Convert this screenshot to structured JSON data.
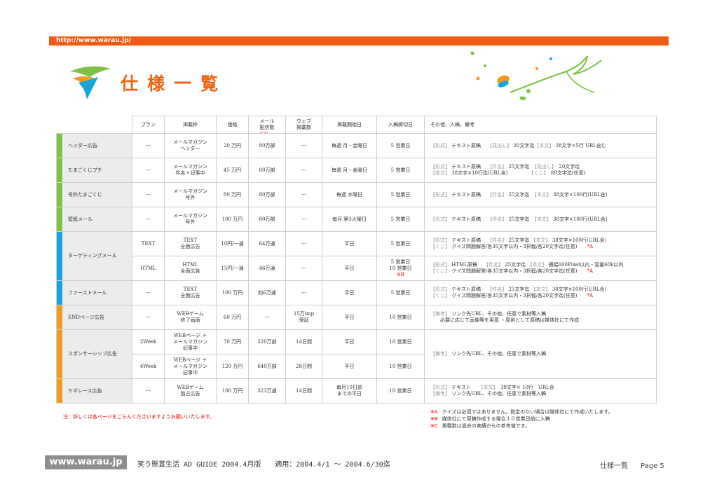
{
  "header": {
    "url": "http://www.warau.jp/"
  },
  "page_title": "仕様一覧",
  "table": {
    "headers": [
      "",
      "プラン",
      "掲載枠",
      "価格",
      "メール\n配信数",
      "ウェブ\n掲載数",
      "掲載開始日",
      "入稿締切日",
      "その他、入稿、備考"
    ],
    "header_note": "※C",
    "rows": {
      "header_ad": {
        "cat": "ヘッダー広告",
        "plan": "---",
        "slot": "メールマガジン\nヘッダー",
        "price": "20 万円",
        "mail": "80万部",
        "web": "---",
        "start": "毎週 月・金曜日",
        "deadline": "5 営業日",
        "spec": {
          "l1_tag": "【形式】",
          "l1_a": " テキスト原稿　 ",
          "l1_tag2": "【見出し】",
          "l1_b": " 20文字迄",
          "l1_tag3": "【本文】",
          "l1_c": " 38文字×5行 URL含む"
        }
      },
      "tamagokubuchi": {
        "cat": "たまごくじプチ",
        "plan": "---",
        "slot": "メールマガジン\n件名＋記事中",
        "price": "45 万円",
        "mail": "80万部",
        "web": "---",
        "start": "毎週 月・金曜日",
        "deadline": "5 営業日",
        "spec": {
          "l1_tag": "【形式】",
          "l1_a": " テキスト原稿　 ",
          "l1_tag2": "【件名】",
          "l1_b": " 25文字迄　",
          "l1_tag3": "【見出し】",
          "l1_c": "　20文字迄",
          "l2_tag": "【本文】",
          "l2_a": " 38文字×10行迄(URL含)　　　　 ",
          "l2_tag2": "【くじ】",
          "l2_b": "　80文字迄(任意)"
        }
      },
      "gougai": {
        "cat": "号外たまごくじ",
        "plan": "---",
        "slot": "メールマガジン\n号外",
        "price": "80 万円",
        "mail": "80万部",
        "web": "---",
        "start": "毎週 水曜日",
        "deadline": "5 営業日",
        "spec": {
          "l1_tag": "【形式】",
          "l1_a": " テキスト原稿　 ",
          "l1_tag2": "【件名】",
          "l1_b": " 25文字迄　",
          "l1_tag3": "【本文】",
          "l1_c": " 38文字×100行(URL含)"
        }
      },
      "kabegami": {
        "cat": "壁紙メール",
        "plan": "---",
        "slot": "メールマガジン\n号外",
        "price": "100 万円",
        "mail": "80万部",
        "web": "---",
        "start": "毎月 第3火曜日",
        "deadline": "5 営業日",
        "spec": {
          "l1_tag": "【形式】",
          "l1_a": " テキスト原稿　 ",
          "l1_tag2": "【件名】",
          "l1_b": " 25文字迄　",
          "l1_tag3": "【本文】",
          "l1_c": " 38文字×100行(URL含)"
        }
      },
      "targeting": {
        "cat": "ターゲティングメール",
        "text": {
          "plan": "TEXT",
          "slot": "TEXT\n全面広告",
          "price": "10円/一通",
          "mail": "64万通",
          "web": "---",
          "start": "平日",
          "deadline": "5 営業日",
          "spec": {
            "l1_tag": "【形式】",
            "l1_a": " テキスト原稿　 ",
            "l1_tag2": "【件名】",
            "l1_b": " 25文字迄 ",
            "l1_tag3": "【本文】",
            "l1_c": " 38文字×100行(URL含)",
            "l2_tag": "【くじ】",
            "l2_a": " クイズ問題解答/各35文字以内・3択程/各20文字迄(任意)　　",
            "l2_mark": "*A"
          }
        },
        "html": {
          "plan": "HTML",
          "slot": "HTML\n全面広告",
          "price": "15円/一通",
          "mail": "46万通",
          "web": "---",
          "start": "平日",
          "deadline": "5 営業日\n10 営業日",
          "deadline_note": "※B",
          "spec": {
            "l1_tag": "【形式】",
            "l1_a": " HTML原稿　 ",
            "l1_tag2": "【件名】",
            "l1_b": " 25文字迄 ",
            "l1_tag3": "【本文】",
            "l1_c": " 横幅600Pixel以内・容量60k以内",
            "l2_tag": "【くじ】",
            "l2_a": " クイズ問題解答/各35文字以内・3択程/各20文字迄(任意)　　",
            "l2_mark": "*A"
          }
        }
      },
      "first": {
        "cat": "ファーストメール",
        "plan": "---",
        "slot": "TEXT\n全面広告",
        "price": "100 万円",
        "mail": "約6万通",
        "web": "---",
        "start": "平日",
        "deadline": "5 営業日",
        "spec": {
          "l1_tag": "【形式】",
          "l1_a": " テキスト原稿　 ",
          "l1_tag2": "【件名】",
          "l1_b": " 25文字迄 ",
          "l1_tag3": "【本文】",
          "l1_c": " 38文字×100行(URL含)",
          "l2_tag": "【くじ】",
          "l2_a": " クイズ問題解答/各35文字以内・3択程/各20文字迄(任意)　　",
          "l2_mark": "*A"
        }
      },
      "endpage": {
        "cat": "ENDページ広告",
        "plan": "---",
        "slot": "WEBゲーム\n終了画面",
        "price": "60 万円",
        "mail": "---",
        "web": "15万imp\n保証",
        "start": "平日",
        "deadline": "10 営業日",
        "spec": {
          "l1_tag": "【備考】",
          "l1_a": " リンク先URL、その他、任意で素材等入稿",
          "l2_a": "　　必要に応じて画像等を用意 ・原則として原稿は媒体社にて作成"
        }
      },
      "sponsor": {
        "cat": "スポンサーシップ広告",
        "w2": {
          "plan": "2Week",
          "slot": "WEBページ ＋\nメールマガジン\n記事中",
          "price": "70 万円",
          "mail": "320万部",
          "web": "14日間",
          "start": "平日",
          "deadline": "10 営業日"
        },
        "w4": {
          "plan": "4Week",
          "slot": "WEBページ ＋\nメールマガジン\n記事中",
          "price": "120 万円",
          "mail": "640万部",
          "web": "28日間",
          "start": "平日",
          "deadline": "10 営業日"
        },
        "spec": {
          "l1_tag": "【備考】",
          "l1_a": " リンク先URL、その他、任意で素材等入稿"
        }
      },
      "yagiremo": {
        "cat": "ヤギレース広告",
        "plan": "---",
        "slot": "WEBゲーム\n独占広告",
        "price": "100 万円",
        "mail": "323万通",
        "web": "14日間",
        "start": "毎月10日前\nまでの平日",
        "deadline": "10 営業日",
        "spec": {
          "l1_tag": "【形式】",
          "l1_a": " テキスト　　",
          "l1_tag2": "【本文】",
          "l1_b": "　38文字× 10行　URL含",
          "l2_tag": "【備考】",
          "l2_a": " リンク先URL、その他、任意で素材等入稿"
        }
      }
    }
  },
  "notes": {
    "left": "注：詳しくは各ページをごらんくださいますようお願いいたします。",
    "right": [
      {
        "key": "※A",
        "text": "クイズは必須ではありません。指定のない場合は媒体社にて作成いたします。"
      },
      {
        "key": "※B",
        "text": "媒体社にて原稿作成する場合１０営業日前に入稿"
      },
      {
        "key": "※C",
        "text": "掲載数は過去の実績からの参考値です。"
      }
    ]
  },
  "footer": {
    "logo": "www.warau.jp",
    "guide": "笑う懸賞生活 AD GUIDE 2004.4月版　　適用：2004.4/1 ～ 2004.6/30迄",
    "section": "仕様一覧",
    "page": "Page 5"
  },
  "colors": {
    "brand_orange": "#f05a14",
    "green": "#7dc242",
    "blue": "#1aa3d9",
    "orange": "#f39a1f",
    "red": "#e00000"
  }
}
